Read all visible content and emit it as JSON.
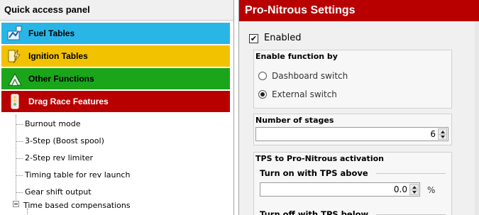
{
  "left_panel": {
    "header": "Quick access panel",
    "categories": [
      {
        "label": "Fuel Tables",
        "icon": "fuel-table-icon",
        "color": "#29b6e6"
      },
      {
        "label": "Ignition Tables",
        "icon": "ignition-icon",
        "color": "#f2c200"
      },
      {
        "label": "Other Functions",
        "icon": "functions-icon",
        "color": "#1ba51b"
      },
      {
        "label": "Drag Race Features",
        "icon": "drag-race-icon",
        "color": "#b80000"
      }
    ],
    "tree_items": [
      "Burnout mode",
      "3-Step (Boost spool)",
      "2-Step rev limiter",
      "Timing table for rev launch",
      "Gear shift output",
      "Time based compensations"
    ]
  },
  "right_panel": {
    "title": "Pro-Nitrous Settings",
    "enabled_label": "Enabled",
    "enabled_checked": true,
    "enable_group": {
      "title": "Enable function by",
      "options": [
        "Dashboard switch",
        "External switch"
      ],
      "selected": "External switch"
    },
    "stages_group": {
      "title": "Number of stages",
      "value": "6"
    },
    "tps_group": {
      "title": "TPS to Pro-Nitrous activation",
      "turn_on_label": "Turn on with TPS above",
      "turn_on_value": "0.0",
      "turn_on_unit": "%",
      "turn_off_label": "Turn off with TPS below"
    }
  }
}
